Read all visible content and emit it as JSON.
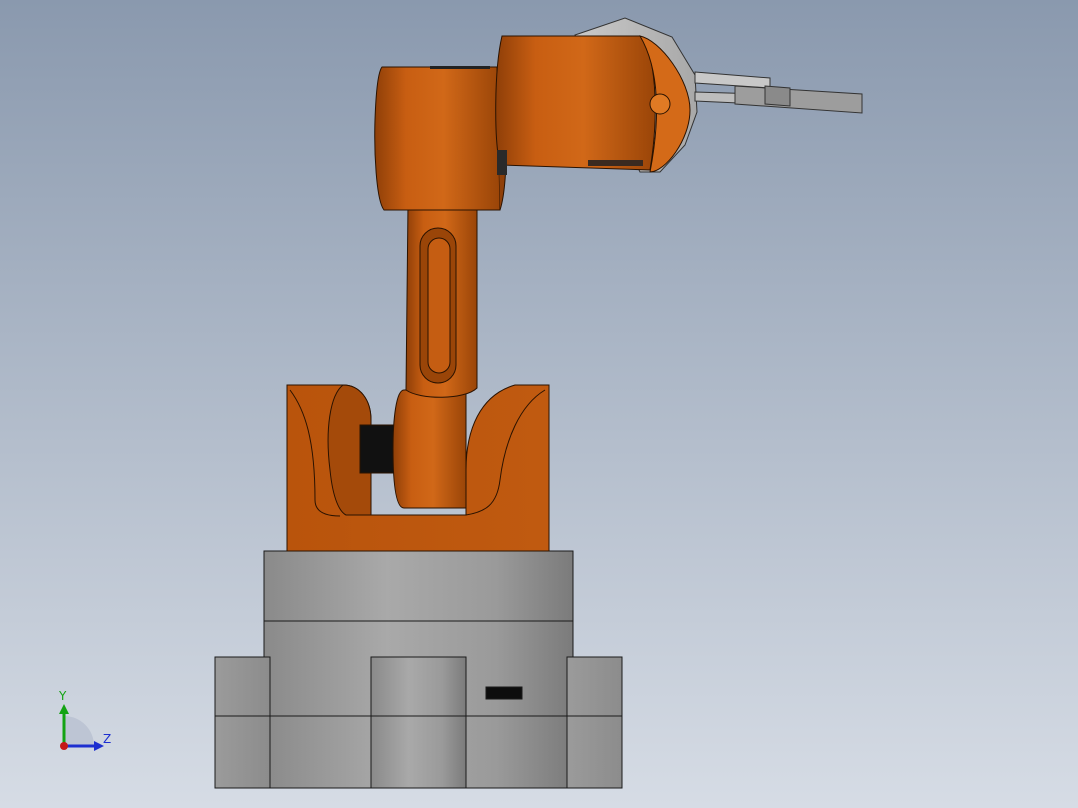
{
  "scene": {
    "background_top": "#8a99ae",
    "background_bottom": "#d6dce5",
    "part_color": "#c0560c",
    "base_color": "#9a9a9a"
  },
  "triad": {
    "y_label": "Y",
    "z_label": "Z",
    "y_color": "#13a313",
    "z_color": "#1d2fd0",
    "x_color": "#c41818"
  }
}
